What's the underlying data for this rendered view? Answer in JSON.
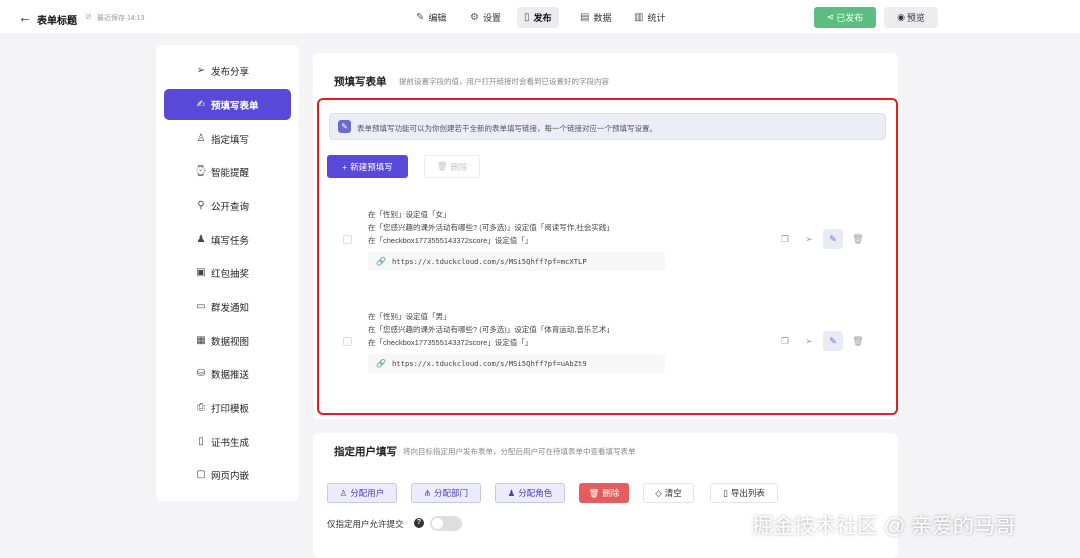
{
  "header": {
    "back_icon": "arrow-left-icon",
    "title": "表单标题",
    "save_status": "最近保存 14:13",
    "tabs": [
      {
        "label": "编辑",
        "icon": "edit-icon"
      },
      {
        "label": "设置",
        "icon": "gear-icon"
      },
      {
        "label": "发布",
        "icon": "publish-icon",
        "active": true
      },
      {
        "label": "数据",
        "icon": "data-icon"
      },
      {
        "label": "统计",
        "icon": "stats-icon"
      }
    ],
    "published_label": "已发布",
    "preview_label": "预览"
  },
  "sidebar": {
    "items": [
      {
        "label": "发布分享",
        "icon": "send-icon"
      },
      {
        "label": "预填写表单",
        "icon": "prefill-icon",
        "active": true
      },
      {
        "label": "指定填写",
        "icon": "user-icon"
      },
      {
        "label": "智能提醒",
        "icon": "bell-icon"
      },
      {
        "label": "公开查询",
        "icon": "search-list-icon"
      },
      {
        "label": "填写任务",
        "icon": "users-icon"
      },
      {
        "label": "红包抽奖",
        "icon": "gift-icon"
      },
      {
        "label": "群发通知",
        "icon": "message-icon"
      },
      {
        "label": "数据视图",
        "icon": "table-icon"
      },
      {
        "label": "数据推送",
        "icon": "database-icon"
      },
      {
        "label": "打印模板",
        "icon": "print-icon"
      },
      {
        "label": "证书生成",
        "icon": "certificate-icon"
      },
      {
        "label": "网页内嵌",
        "icon": "embed-icon"
      }
    ]
  },
  "prefill": {
    "title": "预填写表单",
    "description": "提前设置字段的值，用户打开链接时会看到已设置好的字段内容",
    "notice": "表单预填写功能可以为你创建若干全新的表单填写链接，每一个链接对应一个预填写设置。",
    "new_label": "新建预填写",
    "delete_label": "删除",
    "rows": [
      {
        "lines": [
          "在「性别」设定值「女」",
          "在「您感兴趣的课外活动有哪些? (可多选)」设定值「阅读写作,社会实践」",
          "在「checkbox1773555143372score」设定值「」"
        ],
        "link": "https://x.tduckcloud.com/s/MSi5Qhff?pf=mcXTLP"
      },
      {
        "lines": [
          "在「性别」设定值「男」",
          "在「您感兴趣的课外活动有哪些? (可多选)」设定值「体育运动,音乐艺术」",
          "在「checkbox1773555143372score」设定值「」"
        ],
        "link": "https://x.tduckcloud.com/s/MSi5Qhff?pf=uAbZt9"
      }
    ]
  },
  "assign": {
    "title": "指定用户填写",
    "description": "将向目标指定用户发布表单，分配后用户可在待填表单中查看填写表单",
    "buttons": {
      "assign_user": "分配用户",
      "assign_dept": "分配部门",
      "assign_role": "分配角色",
      "delete": "删除",
      "clear": "清空",
      "export": "导出列表"
    },
    "toggle_label": "仅指定用户允许提交",
    "toggle_on": false
  },
  "watermark": "掘金技术社区 @ 亲爱的马哥",
  "colors": {
    "accent": "#5a48d8",
    "published": "#5bbd7f",
    "danger": "#e45c5c",
    "highlight": "#e02020"
  }
}
